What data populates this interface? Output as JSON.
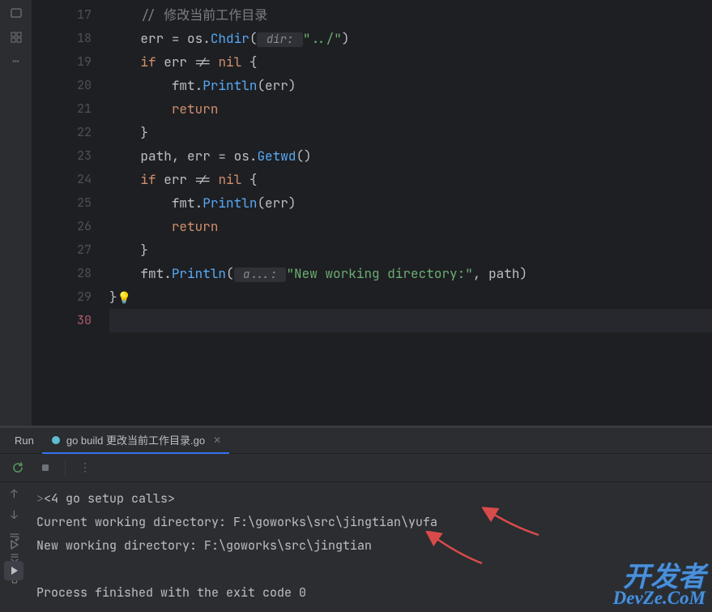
{
  "editor": {
    "lines": [
      {
        "n": "17",
        "indent": "    ",
        "tokens": [
          {
            "c": "cm",
            "t": "// 修改当前工作目录"
          }
        ]
      },
      {
        "n": "18",
        "indent": "    ",
        "tokens": [
          {
            "c": "id",
            "t": "err "
          },
          {
            "c": "op",
            "t": "= "
          },
          {
            "c": "pkg",
            "t": "os"
          },
          {
            "c": "op",
            "t": "."
          },
          {
            "c": "fn",
            "t": "Chdir"
          },
          {
            "c": "pr",
            "t": "("
          },
          {
            "c": "hint",
            "t": " dir: "
          },
          {
            "c": "str",
            "t": "\"../\""
          },
          {
            "c": "pr",
            "t": ")"
          }
        ]
      },
      {
        "n": "19",
        "indent": "    ",
        "tokens": [
          {
            "c": "kw",
            "t": "if "
          },
          {
            "c": "id",
            "t": "err "
          },
          {
            "c": "op",
            "t": "!= "
          },
          {
            "c": "kw",
            "t": "nil "
          },
          {
            "c": "pr",
            "t": "{"
          }
        ]
      },
      {
        "n": "20",
        "indent": "        ",
        "tokens": [
          {
            "c": "pkg",
            "t": "fmt"
          },
          {
            "c": "op",
            "t": "."
          },
          {
            "c": "fn",
            "t": "Println"
          },
          {
            "c": "pr",
            "t": "("
          },
          {
            "c": "id",
            "t": "err"
          },
          {
            "c": "pr",
            "t": ")"
          }
        ]
      },
      {
        "n": "21",
        "indent": "        ",
        "tokens": [
          {
            "c": "kw",
            "t": "return"
          }
        ]
      },
      {
        "n": "22",
        "indent": "    ",
        "tokens": [
          {
            "c": "pr",
            "t": "}"
          }
        ]
      },
      {
        "n": "23",
        "indent": "    ",
        "tokens": [
          {
            "c": "id",
            "t": "path"
          },
          {
            "c": "op",
            "t": ", "
          },
          {
            "c": "id",
            "t": "err "
          },
          {
            "c": "op",
            "t": "= "
          },
          {
            "c": "pkg",
            "t": "os"
          },
          {
            "c": "op",
            "t": "."
          },
          {
            "c": "fn",
            "t": "Getwd"
          },
          {
            "c": "pr",
            "t": "()"
          }
        ]
      },
      {
        "n": "24",
        "indent": "    ",
        "tokens": [
          {
            "c": "kw",
            "t": "if "
          },
          {
            "c": "id",
            "t": "err "
          },
          {
            "c": "op",
            "t": "!= "
          },
          {
            "c": "kw",
            "t": "nil "
          },
          {
            "c": "pr",
            "t": "{"
          }
        ]
      },
      {
        "n": "25",
        "indent": "        ",
        "tokens": [
          {
            "c": "pkg",
            "t": "fmt"
          },
          {
            "c": "op",
            "t": "."
          },
          {
            "c": "fn",
            "t": "Println"
          },
          {
            "c": "pr",
            "t": "("
          },
          {
            "c": "id",
            "t": "err"
          },
          {
            "c": "pr",
            "t": ")"
          }
        ]
      },
      {
        "n": "26",
        "indent": "        ",
        "tokens": [
          {
            "c": "kw",
            "t": "return"
          }
        ]
      },
      {
        "n": "27",
        "indent": "    ",
        "tokens": [
          {
            "c": "pr",
            "t": "}"
          }
        ]
      },
      {
        "n": "28",
        "indent": "    ",
        "tokens": [
          {
            "c": "pkg",
            "t": "fmt"
          },
          {
            "c": "op",
            "t": "."
          },
          {
            "c": "fn",
            "t": "Println"
          },
          {
            "c": "pr",
            "t": "("
          },
          {
            "c": "hint",
            "t": " a...: "
          },
          {
            "c": "str",
            "t": "\"New working directory:\""
          },
          {
            "c": "op",
            "t": ", "
          },
          {
            "c": "id",
            "t": "path"
          },
          {
            "c": "pr",
            "t": ")"
          }
        ]
      },
      {
        "n": "29",
        "indent": "",
        "tokens": [
          {
            "c": "pr",
            "t": "}"
          },
          {
            "c": "bulb",
            "t": "💡"
          }
        ]
      },
      {
        "n": "30",
        "indent": "",
        "tokens": [],
        "current": true,
        "last": true
      }
    ]
  },
  "run": {
    "label": "Run",
    "tab": "go build 更改当前工作目录.go"
  },
  "console": {
    "setup": "<4 go setup calls>",
    "l1": "Current working directory: F:\\goworks\\src\\jingtian\\yufa",
    "l2": "New working directory: F:\\goworks\\src\\jingtian",
    "finish": "Process finished with the exit code 0"
  },
  "watermark": {
    "l1": "开发者",
    "l2": "DevZe.CoM"
  }
}
